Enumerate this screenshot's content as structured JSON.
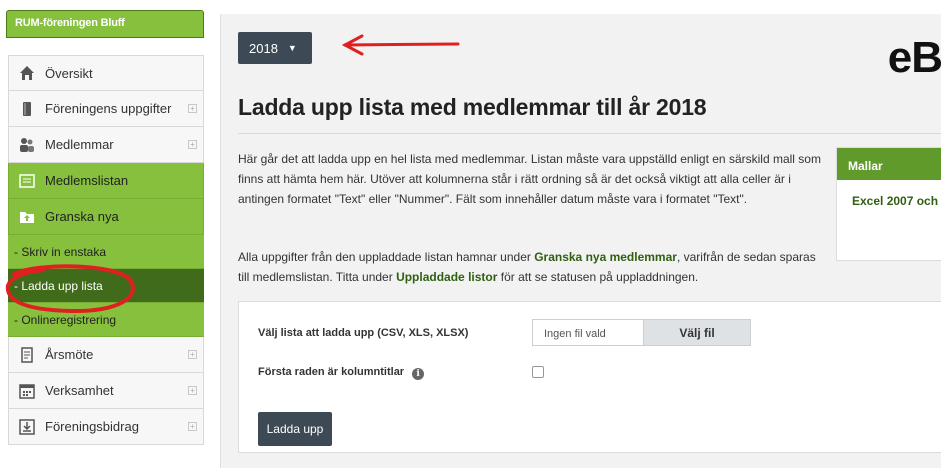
{
  "sidebar": {
    "org_name": "RUM-föreningen Bluff",
    "items": [
      {
        "label": "Översikt",
        "icon": "home-icon",
        "expandable": false
      },
      {
        "label": "Föreningens uppgifter",
        "icon": "book-icon",
        "expandable": true
      },
      {
        "label": "Medlemmar",
        "icon": "members-icon",
        "expandable": true
      },
      {
        "label": "Medlemslistan",
        "icon": "member-list-icon",
        "expandable": false
      },
      {
        "label": "Granska nya",
        "icon": "folder-icon",
        "expandable": false
      }
    ],
    "sub_items": [
      "- Skriv in enstaka",
      "- Ladda upp lista",
      "- Onlineregistrering"
    ],
    "more_items": [
      {
        "label": "Årsmöte",
        "icon": "document-icon",
        "expandable": true
      },
      {
        "label": "Verksamhet",
        "icon": "calendar-icon",
        "expandable": true
      },
      {
        "label": "Föreningsbidrag",
        "icon": "download-box-icon",
        "expandable": true
      }
    ]
  },
  "header": {
    "year_selected": "2018",
    "brand_partial": "eB"
  },
  "main": {
    "title": "Ladda upp lista med medlemmar till år 2018",
    "para1": "Här går det att ladda upp en hel lista med medlemmar. Listan måste vara uppställd enligt en särskild mall som finns att hämta hem här. Utöver att kolumnerna står i rätt ordning så är det också viktigt att alla celler är i antingen formatet \"Text\" eller \"Nummer\". Fält som innehåller datum måste vara i formatet \"Text\".",
    "para2_before": "Alla uppgifter från den uppladdade listan hamnar under ",
    "para2_link1": "Granska nya medlemmar",
    "para2_middle": ", varifrån de sedan sparas till medlemslistan. Titta under ",
    "para2_link2": "Uppladdade listor",
    "para2_after": " för att se statusen på uppladdningen."
  },
  "templates": {
    "title": "Mallar",
    "link": "Excel 2007 och"
  },
  "upload_form": {
    "file_label": "Välj lista att ladda upp (CSV, XLS, XLSX)",
    "no_file": "Ingen fil vald",
    "choose_file": "Välj fil",
    "first_row_label": "Första raden är kolumntitlar",
    "first_row_checked": false,
    "submit_label": "Ladda upp"
  },
  "colors": {
    "sidebar_green": "#86c03c",
    "active_dark_green": "#3f6b1b",
    "button_dark": "#3d4a55",
    "annotation_red": "#e02020"
  }
}
